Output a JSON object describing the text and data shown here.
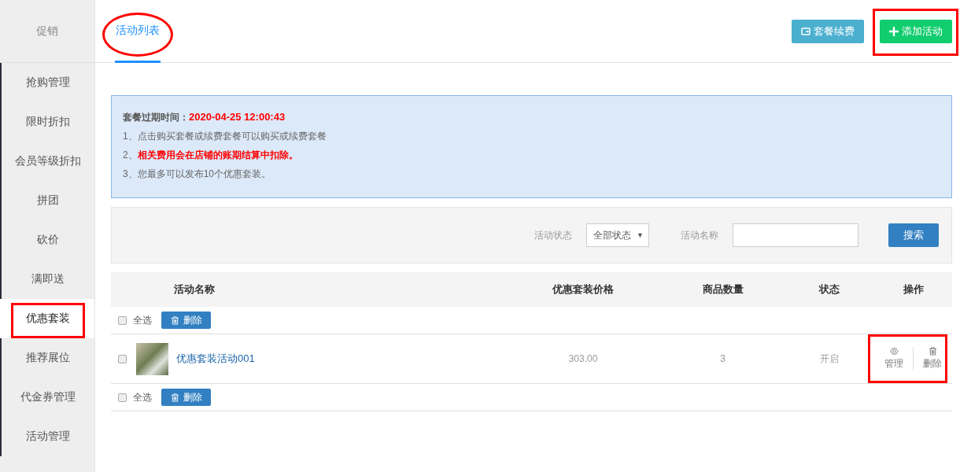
{
  "sidebar": {
    "header": "促销",
    "items": [
      {
        "label": "抢购管理",
        "selected": false,
        "highlighted": false
      },
      {
        "label": "限时折扣",
        "selected": false,
        "highlighted": false
      },
      {
        "label": "会员等级折扣",
        "selected": false,
        "highlighted": false
      },
      {
        "label": "拼团",
        "selected": false,
        "highlighted": false
      },
      {
        "label": "砍价",
        "selected": false,
        "highlighted": false
      },
      {
        "label": "满即送",
        "selected": false,
        "highlighted": false
      },
      {
        "label": "优惠套装",
        "selected": true,
        "highlighted": true
      },
      {
        "label": "推荐展位",
        "selected": false,
        "highlighted": false
      },
      {
        "label": "代金券管理",
        "selected": false,
        "highlighted": false
      },
      {
        "label": "活动管理",
        "selected": false,
        "highlighted": false
      }
    ]
  },
  "tabs": [
    {
      "label": "活动列表",
      "selected": true,
      "highlighted": true
    }
  ],
  "header_buttons": [
    {
      "kind": "renew",
      "label": "套餐续费",
      "highlighted": false
    },
    {
      "kind": "add",
      "label": "添加活动",
      "highlighted": true
    }
  ],
  "notice": {
    "expiry_label": "套餐过期时间：",
    "expiry_value": "2020-04-25 12:00:43",
    "lines": [
      "1、点击购买套餐或续费套餐可以购买或续费套餐",
      "2、**相关费用会在店铺的账期结算中扣除。**",
      "3、您最多可以发布10个优惠套装。"
    ]
  },
  "filters": [
    {
      "kind": "select",
      "label": "活动状态",
      "value": "全部状态",
      "caret": "▼"
    },
    {
      "kind": "text",
      "label": "活动名称"
    }
  ],
  "search_button": "搜索",
  "table": {
    "columns": [
      "活动名称",
      "优惠套装价格",
      "商品数量",
      "状态",
      "操作"
    ],
    "bulk_top": {
      "checked": false,
      "select_all_label": "全选",
      "delete_label": "删除"
    },
    "rows": [
      {
        "checked": false,
        "name": "优惠套装活动001",
        "price": "303.00",
        "quantity": "3",
        "status": "开启",
        "actions_highlighted": true,
        "actions": [
          {
            "kind": "manage",
            "label": "管理"
          },
          {
            "kind": "delete",
            "label": "删除"
          }
        ]
      }
    ],
    "bulk_bottom": {
      "checked": false,
      "select_all_label": "全选",
      "delete_label": "删除"
    }
  }
}
